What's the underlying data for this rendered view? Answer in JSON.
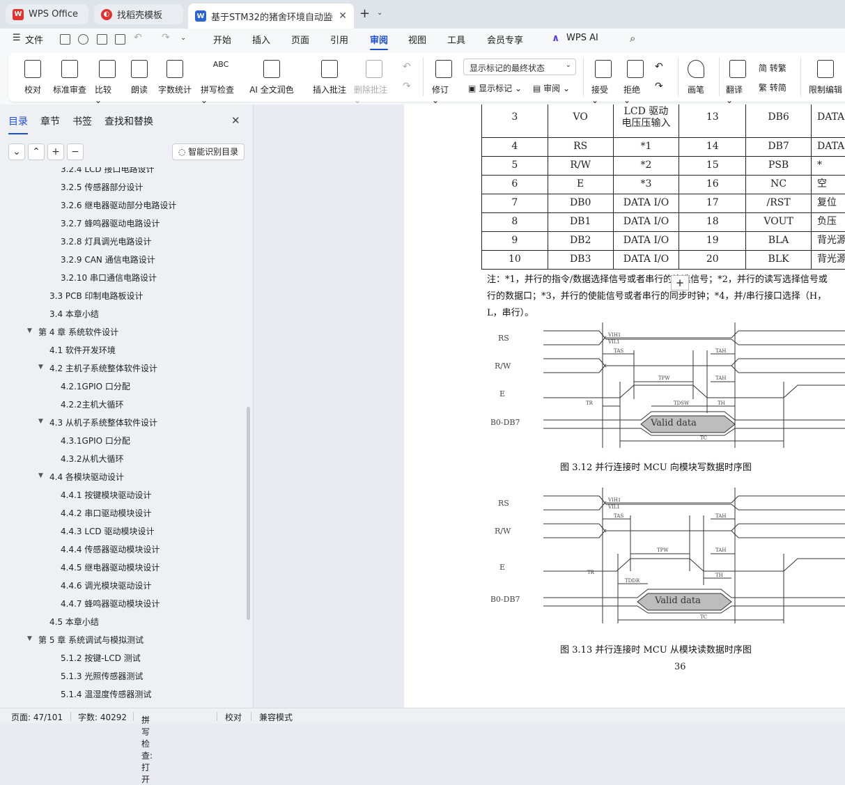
{
  "tabs": [
    {
      "label": "WPS Office",
      "icon": "wps-logo-icon"
    },
    {
      "label": "找稻壳模板",
      "icon": "docer-icon"
    },
    {
      "label": "基于STM32的猪舍环境自动监",
      "icon": "word-doc-icon"
    }
  ],
  "menu": {
    "file": "文件",
    "items": [
      "开始",
      "插入",
      "页面",
      "引用",
      "审阅",
      "视图",
      "工具",
      "会员专享"
    ],
    "selected": "审阅",
    "wps_ai": "WPS AI"
  },
  "ribbon": {
    "buttons": [
      "校对",
      "标准审查",
      "比较",
      "朗读",
      "字数统计",
      "拼写检查",
      "AI 全文润色",
      "插入批注",
      "删除批注",
      "修订"
    ],
    "combo": "显示标记的最终状态",
    "show_markup": "显示标记",
    "review": "审阅",
    "accept": "接受",
    "reject": "拒绝",
    "pen": "画笔",
    "translate": "翻译",
    "to_trad": "简 转繁",
    "to_simp": "繁 转简",
    "restrict": "限制编辑"
  },
  "sidebar": {
    "tabs": [
      "目录",
      "章节",
      "书签",
      "查找和替换"
    ],
    "selected": "目录",
    "smart_toc": "智能识别目录",
    "toc": [
      {
        "label": "3.2.4 LCD 接口电路设计",
        "level": 3
      },
      {
        "label": "3.2.5 传感器部分设计",
        "level": 3
      },
      {
        "label": "3.2.6 继电器驱动部分电路设计",
        "level": 3
      },
      {
        "label": "3.2.7 蜂鸣器驱动电路设计",
        "level": 3
      },
      {
        "label": "3.2.8 灯具调光电路设计",
        "level": 3
      },
      {
        "label": "3.2.9 CAN 通信电路设计",
        "level": 3
      },
      {
        "label": "3.2.10 串口通信电路设计",
        "level": 3
      },
      {
        "label": "3.3 PCB 印制电路板设计",
        "level": 2
      },
      {
        "label": "3.4  本章小结",
        "level": 2
      },
      {
        "label": "第 4 章  系统软件设计",
        "level": 1,
        "expanded": true
      },
      {
        "label": "4.1  软件开发环境",
        "level": 2
      },
      {
        "label": "4.2  主机子系统整体软件设计",
        "level": 2,
        "expanded": true
      },
      {
        "label": "4.2.1GPIO 口分配",
        "level": 3
      },
      {
        "label": "4.2.2主机大循环",
        "level": 3
      },
      {
        "label": "4.3  从机子系统整体软件设计",
        "level": 2,
        "expanded": true
      },
      {
        "label": "4.3.1GPIO 口分配",
        "level": 3
      },
      {
        "label": "4.3.2从机大循环",
        "level": 3
      },
      {
        "label": "4.4  各模块驱动设计",
        "level": 2,
        "expanded": true
      },
      {
        "label": "4.4.1 按键模块驱动设计",
        "level": 3
      },
      {
        "label": "4.4.2 串口驱动模块设计",
        "level": 3
      },
      {
        "label": "4.4.3 LCD 驱动模块设计",
        "level": 3
      },
      {
        "label": "4.4.4 传感器驱动模块设计",
        "level": 3
      },
      {
        "label": "4.4.5 继电器驱动模块设计",
        "level": 3
      },
      {
        "label": "4.4.6 调光模块驱动设计",
        "level": 3
      },
      {
        "label": "4.4.7 蜂鸣器驱动模块设计",
        "level": 3
      },
      {
        "label": "4.5  本章小结",
        "level": 2
      },
      {
        "label": "第 5 章  系统调试与模拟测试",
        "level": 1,
        "expanded": true
      },
      {
        "label": "5.1.2 按键-LCD 测试",
        "level": 3
      },
      {
        "label": "5.1.3 光照传感器测试",
        "level": 3
      },
      {
        "label": "5.1.4 温湿度传感器测试",
        "level": 3
      }
    ]
  },
  "document": {
    "table_rows": [
      [
        "3",
        "VO",
        "LCD 驱动\n电压压输入",
        "13",
        "DB6",
        "DATA"
      ],
      [
        "4",
        "RS",
        "*1",
        "14",
        "DB7",
        "DATA"
      ],
      [
        "5",
        "R/W",
        "*2",
        "15",
        "PSB",
        "*"
      ],
      [
        "6",
        "E",
        "*3",
        "16",
        "NC",
        "空"
      ],
      [
        "7",
        "DB0",
        "DATA I/O",
        "17",
        "/RST",
        "复位"
      ],
      [
        "8",
        "DB1",
        "DATA I/O",
        "18",
        "VOUT",
        "负压"
      ],
      [
        "9",
        "DB2",
        "DATA I/O",
        "19",
        "BLA",
        "背光源"
      ],
      [
        "10",
        "DB3",
        "DATA I/O",
        "20",
        "BLK",
        "背光源"
      ]
    ],
    "note_lines": [
      "注：*1，并行的指令/数据选择信号或者串行的片选信号；*2，并行的读写选择信号或",
      "行的数据口；*3，并行的使能信号或者串行的同步时钟；*4，并/串行接口选择（H，",
      "L，串行）。"
    ],
    "diagram1": {
      "signals": [
        "RS",
        "R/W",
        "E",
        "DB0-DB7"
      ],
      "valid": "Valid data",
      "labels": {
        "vih": "VIH1",
        "vil": "VIL1",
        "tas": "TAS",
        "tah": "TAH",
        "tpw": "TPW",
        "tdsw": "TDSW",
        "th": "TH",
        "tr": "TR",
        "tc": "TC"
      }
    },
    "caption1": "图 3.12  并行连接时 MCU 向模块写数据时序图",
    "diagram2": {
      "signals": [
        "RS",
        "R/W",
        "E",
        "DB0-DB7"
      ],
      "valid": "Valid data",
      "labels": {
        "vih": "VIH1",
        "vil": "VIL1",
        "tas": "TAS",
        "tah": "TAH",
        "tpw": "TPW",
        "tddr": "TDDR",
        "th": "TH",
        "tr": "TR",
        "tc": "TC"
      }
    },
    "caption2": "图 3.13  并行连接时 MCU 从模块读数据时序图",
    "page_number": "36"
  },
  "status": {
    "page": "页面: 47/101",
    "words": "字数: 40292",
    "spell": "拼写检查: 打开",
    "proof": "校对",
    "compat": "兼容模式"
  },
  "colors": {
    "accent": "#1c4fd1",
    "wps_red": "#e5312d"
  }
}
